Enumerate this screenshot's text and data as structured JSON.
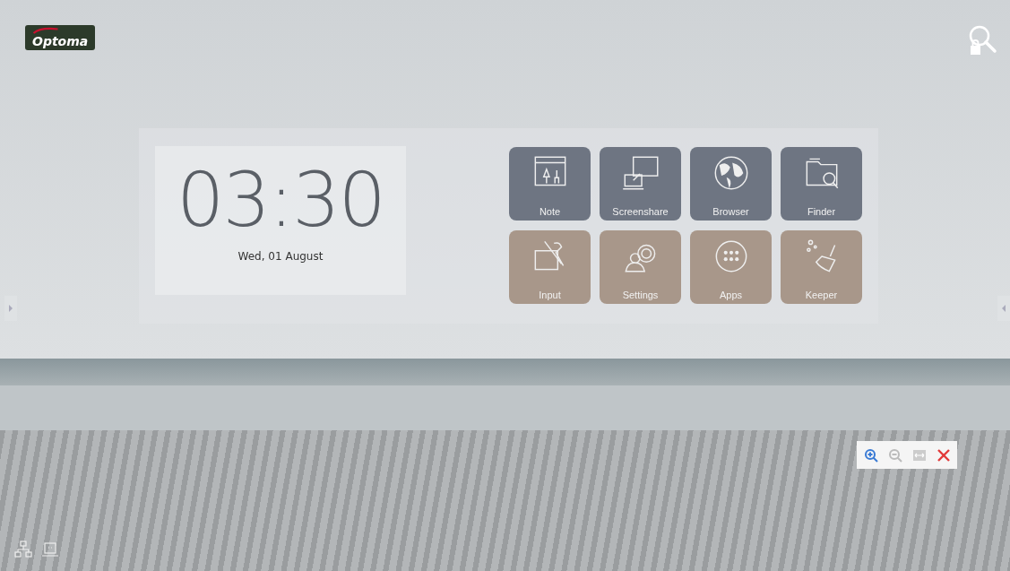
{
  "logo": {
    "text": "Optoma"
  },
  "clock": {
    "time": "03:30",
    "date": "Wed, 01 August"
  },
  "apps": [
    {
      "label": "Note",
      "kind": "note",
      "color": "#6e7582"
    },
    {
      "label": "Screenshare",
      "kind": "screenshare",
      "color": "#6e7582"
    },
    {
      "label": "Browser",
      "kind": "browser",
      "color": "#6e7582"
    },
    {
      "label": "Finder",
      "kind": "finder",
      "color": "#6e7582"
    },
    {
      "label": "Input",
      "kind": "input",
      "color": "#a8978a"
    },
    {
      "label": "Settings",
      "kind": "settings",
      "color": "#a8978a"
    },
    {
      "label": "Apps",
      "kind": "apps",
      "color": "#a8978a"
    },
    {
      "label": "Keeper",
      "kind": "keeper",
      "color": "#a8978a"
    }
  ],
  "zoom_toolbar": [
    {
      "kind": "zoom-in",
      "disabled": false
    },
    {
      "kind": "zoom-out",
      "disabled": true
    },
    {
      "kind": "fit",
      "disabled": true
    },
    {
      "kind": "close",
      "disabled": false
    }
  ]
}
